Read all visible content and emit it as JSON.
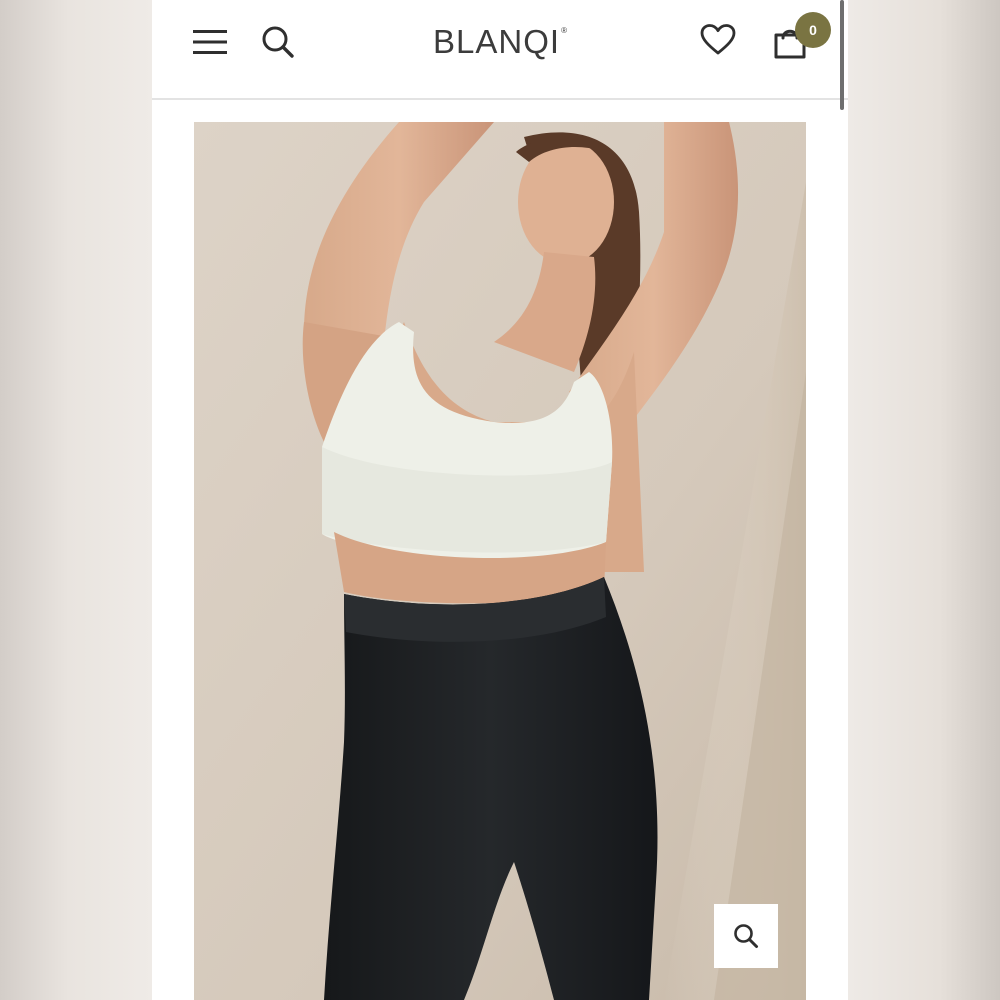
{
  "header": {
    "brand": "BLANQI",
    "brand_mark": "®",
    "cart_count": "0",
    "icons": {
      "menu": "hamburger-menu-icon",
      "search": "search-icon",
      "wishlist": "heart-icon",
      "cart": "shopping-bag-icon"
    }
  },
  "product": {
    "image": "model-in-cream-ribbed-bralette-and-black-leggings",
    "zoom_icon": "magnifier-zoom-icon"
  },
  "colors": {
    "accent": "#7a7442",
    "text": "#3c3c3c",
    "background": "#ffffff",
    "photo_backdrop": "#d9cfc3"
  }
}
